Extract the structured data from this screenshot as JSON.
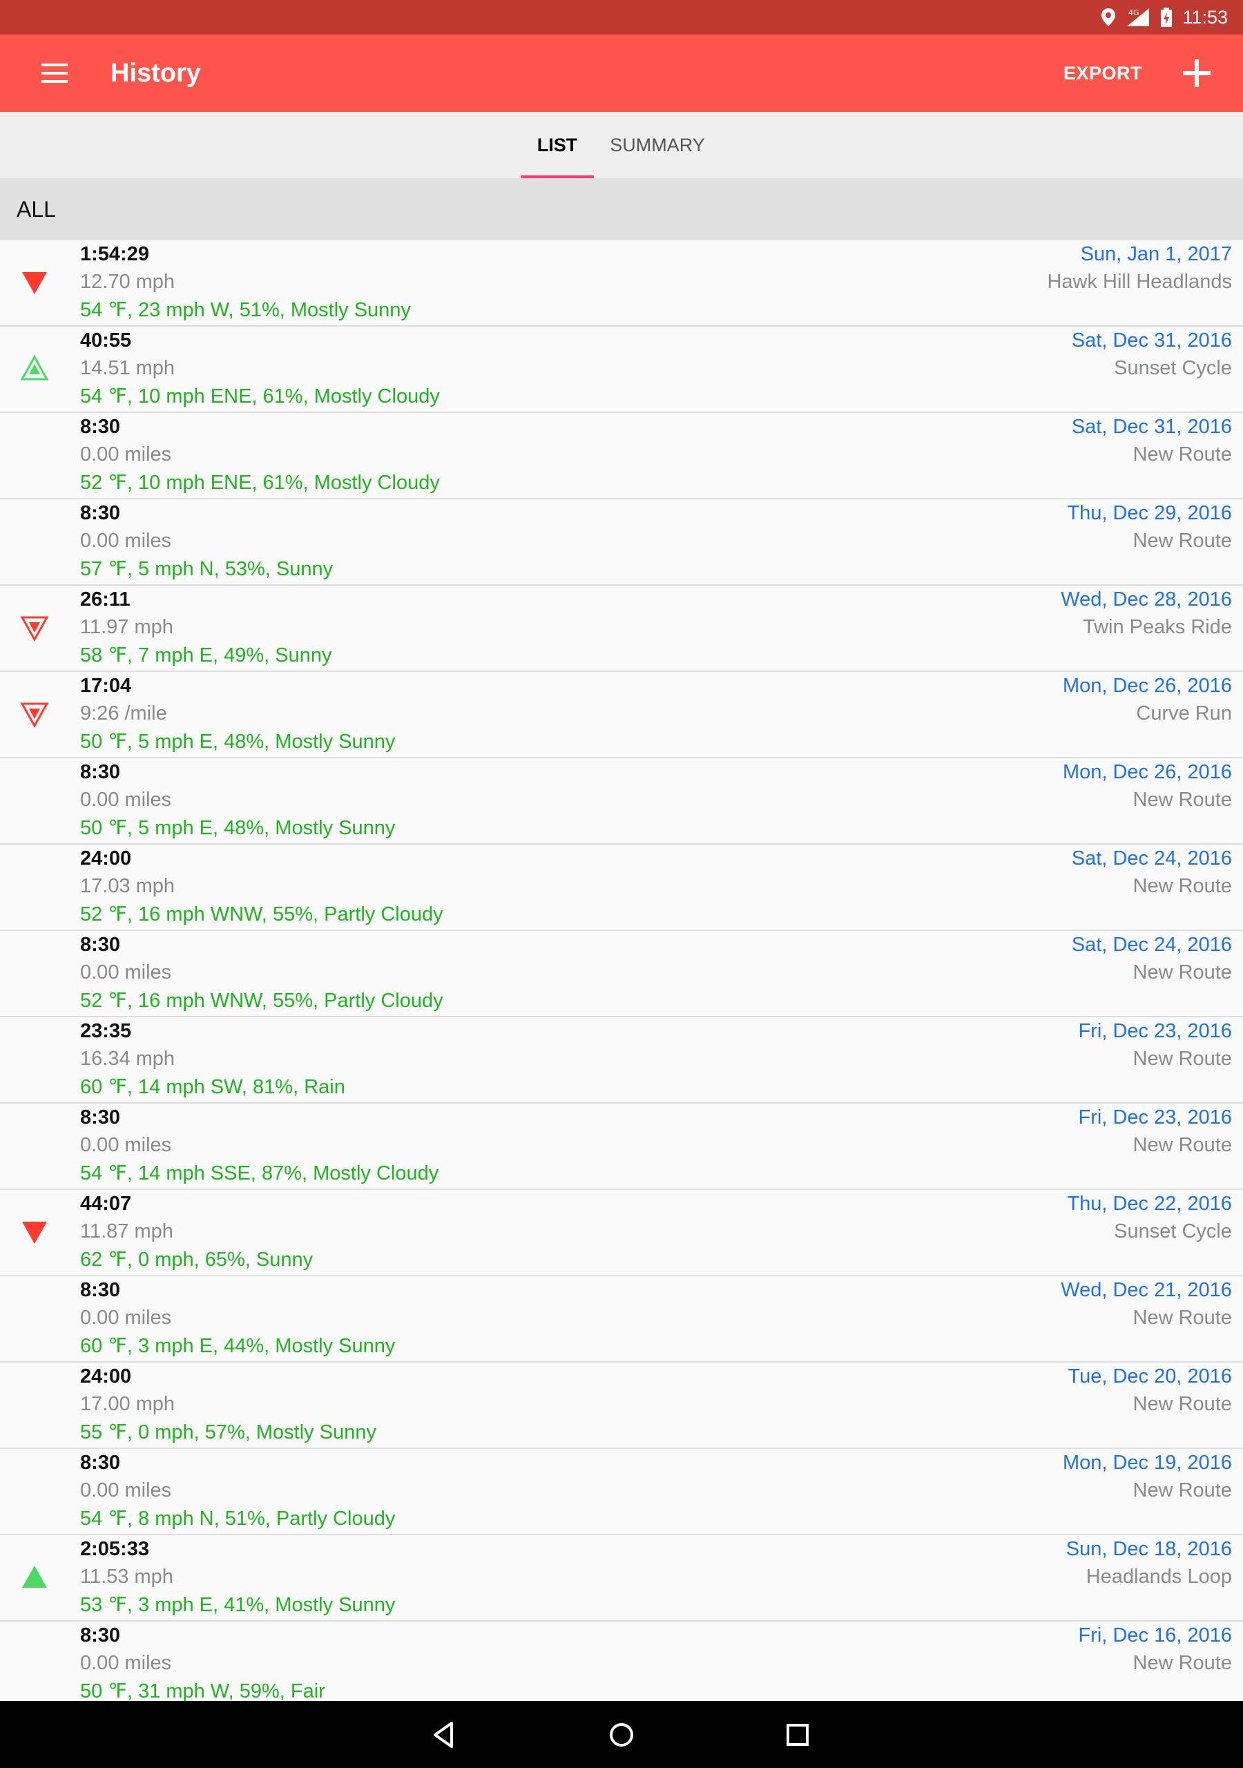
{
  "status_bar": {
    "time": "11:53",
    "network": "4G"
  },
  "toolbar": {
    "title": "History",
    "export_label": "EXPORT"
  },
  "tabs": [
    {
      "label": "LIST"
    },
    {
      "label": "SUMMARY"
    }
  ],
  "filter": {
    "label": "ALL"
  },
  "colors": {
    "toolbar": "#ff544b",
    "status_bar": "#c13a32",
    "accent_tab": "#ff3b6b",
    "date_text": "#1e72e6",
    "weather_text": "#1fb51f",
    "trend_down": "#ff3b30",
    "trend_up": "#4cd964"
  },
  "entries": [
    {
      "duration": "1:54:29",
      "metric": "12.70 mph",
      "weather": "54 ℉, 23 mph W, 51%, Mostly Sunny",
      "date": "Sun, Jan 1, 2017",
      "route": "Hawk Hill Headlands",
      "trend": "down-filled"
    },
    {
      "duration": "40:55",
      "metric": "14.51 mph",
      "weather": "54 ℉, 10 mph ENE, 61%, Mostly Cloudy",
      "date": "Sat, Dec 31, 2016",
      "route": "Sunset Cycle",
      "trend": "up-outline"
    },
    {
      "duration": "8:30",
      "metric": "0.00 miles",
      "weather": "52 ℉, 10 mph ENE, 61%, Mostly Cloudy",
      "date": "Sat, Dec 31, 2016",
      "route": "New Route",
      "trend": "none"
    },
    {
      "duration": "8:30",
      "metric": "0.00 miles",
      "weather": "57 ℉, 5 mph N, 53%, Sunny",
      "date": "Thu, Dec 29, 2016",
      "route": "New Route",
      "trend": "none"
    },
    {
      "duration": "26:11",
      "metric": "11.97 mph",
      "weather": "58 ℉, 7 mph E, 49%, Sunny",
      "date": "Wed, Dec 28, 2016",
      "route": "Twin Peaks Ride",
      "trend": "down-outline"
    },
    {
      "duration": "17:04",
      "metric": "9:26 /mile",
      "weather": "50 ℉, 5 mph E, 48%, Mostly Sunny",
      "date": "Mon, Dec 26, 2016",
      "route": "Curve Run",
      "trend": "down-outline"
    },
    {
      "duration": "8:30",
      "metric": "0.00 miles",
      "weather": "50 ℉, 5 mph E, 48%, Mostly Sunny",
      "date": "Mon, Dec 26, 2016",
      "route": "New Route",
      "trend": "none"
    },
    {
      "duration": "24:00",
      "metric": "17.03 mph",
      "weather": "52 ℉, 16 mph WNW, 55%, Partly Cloudy",
      "date": "Sat, Dec 24, 2016",
      "route": "New Route",
      "trend": "none"
    },
    {
      "duration": "8:30",
      "metric": "0.00 miles",
      "weather": "52 ℉, 16 mph WNW, 55%, Partly Cloudy",
      "date": "Sat, Dec 24, 2016",
      "route": "New Route",
      "trend": "none"
    },
    {
      "duration": "23:35",
      "metric": "16.34 mph",
      "weather": "60 ℉, 14 mph SW, 81%, Rain",
      "date": "Fri, Dec 23, 2016",
      "route": "New Route",
      "trend": "none"
    },
    {
      "duration": "8:30",
      "metric": "0.00 miles",
      "weather": "54 ℉, 14 mph SSE, 87%, Mostly Cloudy",
      "date": "Fri, Dec 23, 2016",
      "route": "New Route",
      "trend": "none"
    },
    {
      "duration": "44:07",
      "metric": "11.87 mph",
      "weather": "62 ℉, 0 mph, 65%, Sunny",
      "date": "Thu, Dec 22, 2016",
      "route": "Sunset Cycle",
      "trend": "down-filled"
    },
    {
      "duration": "8:30",
      "metric": "0.00 miles",
      "weather": "60 ℉, 3 mph E, 44%, Mostly Sunny",
      "date": "Wed, Dec 21, 2016",
      "route": "New Route",
      "trend": "none"
    },
    {
      "duration": "24:00",
      "metric": "17.00 mph",
      "weather": "55 ℉, 0 mph, 57%, Mostly Sunny",
      "date": "Tue, Dec 20, 2016",
      "route": "New Route",
      "trend": "none"
    },
    {
      "duration": "8:30",
      "metric": "0.00 miles",
      "weather": "54 ℉, 8 mph N, 51%, Partly Cloudy",
      "date": "Mon, Dec 19, 2016",
      "route": "New Route",
      "trend": "none"
    },
    {
      "duration": "2:05:33",
      "metric": "11.53 mph",
      "weather": "53 ℉, 3 mph E, 41%, Mostly Sunny",
      "date": "Sun, Dec 18, 2016",
      "route": "Headlands Loop",
      "trend": "up-filled"
    },
    {
      "duration": "8:30",
      "metric": "0.00 miles",
      "weather": "50 ℉, 31 mph W, 59%, Fair",
      "date": "Fri, Dec 16, 2016",
      "route": "New Route",
      "trend": "none"
    }
  ]
}
